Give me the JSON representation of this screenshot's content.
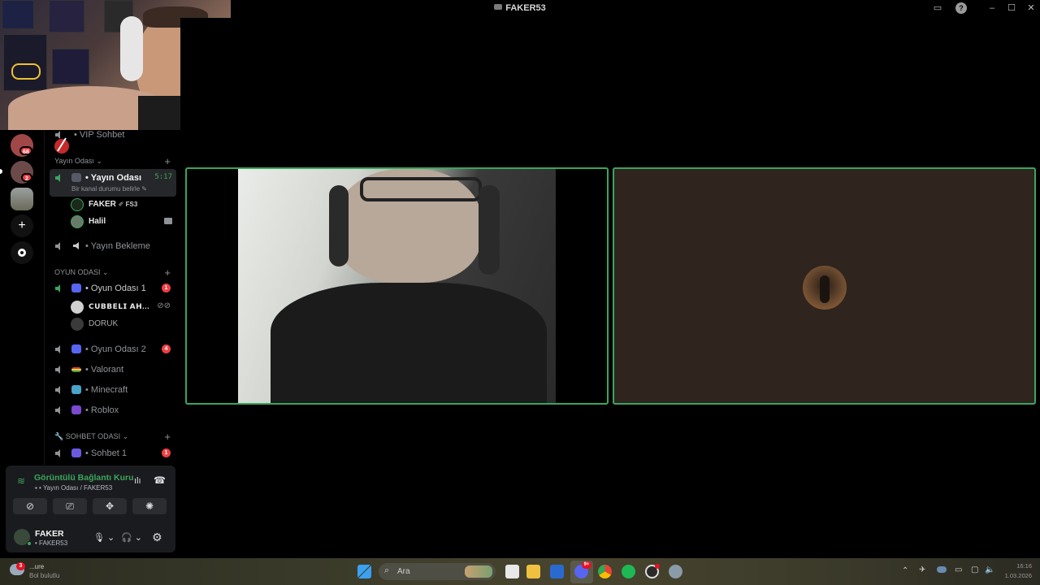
{
  "window": {
    "title": "FAKER53",
    "controls": [
      "inbox-icon",
      "help-icon",
      "minimize-icon",
      "maximize-icon",
      "close-icon"
    ]
  },
  "servers": [
    {
      "badge": "68",
      "color": "#a04848"
    },
    {
      "badge": "2",
      "color": "#6c4a4a"
    },
    {
      "badge": "",
      "color": "#8a8a7a"
    }
  ],
  "server_actions": {
    "add": "+",
    "discover": "compass-icon"
  },
  "channels": {
    "top_channel": "VIP Sohbet",
    "cat_yayin": "Yayın Odası",
    "active": {
      "name": "Yayın Odası",
      "timer": "5:17",
      "status": "Bir kanal durumu belirle"
    },
    "users_yayin": [
      {
        "name": "FAKER",
        "tag": "FS3"
      },
      {
        "name": "Halil"
      }
    ],
    "yayin_bekleme": "Yayın Bekleme",
    "cat_oyun": "OYUN ODASI",
    "oyun1": {
      "name": "Oyun Odası 1",
      "count": "1"
    },
    "users_oyun": [
      {
        "name": "𝗖𝗨𝗕𝗕𝗘𝗟𝗜 𝗔𝗛..."
      },
      {
        "name": "DORUK"
      }
    ],
    "oyun2": {
      "name": "Oyun Odası 2",
      "count": "4"
    },
    "valorant": "Valorant",
    "minecraft": "Minecraft",
    "roblox": "Roblox",
    "cat_sohbet": "SOHBET ODASI",
    "sohbet1": {
      "name": "Sohbet 1",
      "count": "1"
    }
  },
  "voice": {
    "status": "Görüntülü Bağlantı Kuru",
    "channel_path": "Yayın Odası / FAKER53"
  },
  "user_panel": {
    "name": "FAKER",
    "subtitle": "FAKER53"
  },
  "taskbar": {
    "search_placeholder": "Ara",
    "weather_badge": "3",
    "weather_text": "...ure",
    "weather_sub": "Bol bulutlu",
    "time": "16:16",
    "date": "1.03.2026",
    "discord_badge": "9+"
  },
  "accent": {
    "green": "#3ba55d",
    "red": "#f23f43"
  }
}
